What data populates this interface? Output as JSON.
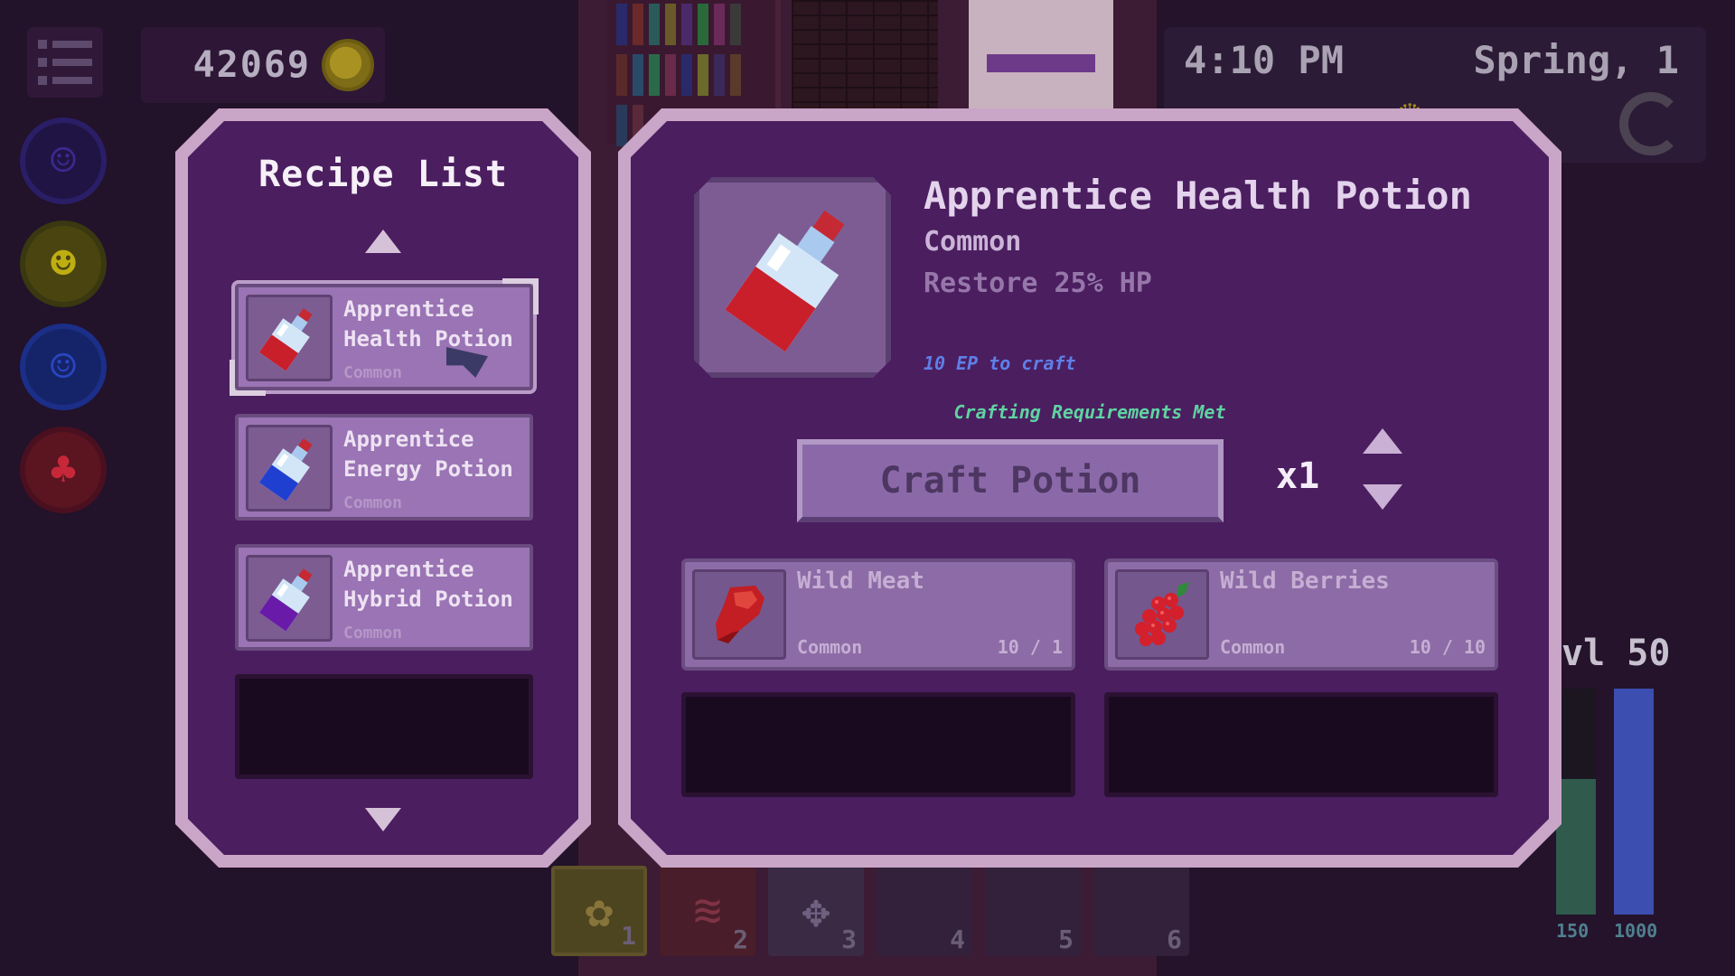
{
  "hud": {
    "gold": "42069",
    "time": "4:10 PM",
    "season": "Spring, 1",
    "level": "vl 50",
    "stat_left_value": "150",
    "stat_right_value": "1000",
    "stat_left_fill": 0.6,
    "stat_right_fill": 1.0
  },
  "party": [
    {
      "icon": "ghost-icon"
    },
    {
      "icon": "yellow-creature-icon"
    },
    {
      "icon": "blue-creature-icon"
    },
    {
      "icon": "red-creature-icon"
    }
  ],
  "hotbar": [
    {
      "num": "1",
      "icon": "gear-icon"
    },
    {
      "num": "2",
      "icon": "claw-icon"
    },
    {
      "num": "3",
      "icon": "move-arrows-icon"
    },
    {
      "num": "4",
      "icon": ""
    },
    {
      "num": "5",
      "icon": ""
    },
    {
      "num": "6",
      "icon": ""
    }
  ],
  "recipe_list": {
    "title": "Recipe List",
    "items": [
      {
        "name": "Apprentice Health Potion",
        "rarity": "Common",
        "liquid": "#c81f2b",
        "selected": true
      },
      {
        "name": "Apprentice Energy Potion",
        "rarity": "Common",
        "liquid": "#1f3fd0",
        "selected": false
      },
      {
        "name": "Apprentice Hybrid Potion",
        "rarity": "Common",
        "liquid": "#6a1aa8",
        "selected": false
      }
    ]
  },
  "detail": {
    "title": "Apprentice Health Potion",
    "rarity": "Common",
    "description": "Restore 25% HP",
    "cost": "10 EP to craft",
    "status": "Crafting Requirements Met",
    "craft_label": "Craft Potion",
    "quantity": "x1",
    "ingredients": [
      {
        "name": "Wild Meat",
        "rarity": "Common",
        "count": "10 / 1",
        "icon": "meat-icon"
      },
      {
        "name": "Wild Berries",
        "rarity": "Common",
        "count": "10 / 10",
        "icon": "berries-icon"
      }
    ]
  },
  "colors": {
    "panel_border": "#c9a5c8",
    "panel_bg": "#4b1e5f",
    "status_green": "#5fd3a2",
    "cost_blue": "#5f7fe8"
  }
}
